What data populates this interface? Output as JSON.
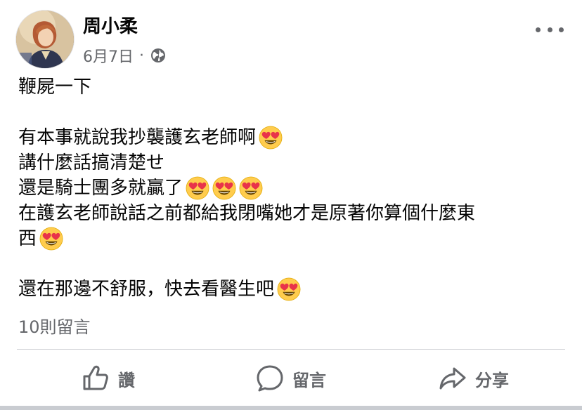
{
  "post": {
    "author_name": "周小柔",
    "date": "6月7日",
    "separator": "·",
    "privacy_icon": "globe-icon",
    "menu_icon": "more-horizontal-icon",
    "lines": [
      {
        "text": "鞭屍一下",
        "emoji_count": 0
      },
      {
        "text": "",
        "emoji_count": 0
      },
      {
        "text": "有本事就說我抄襲護玄老師啊",
        "emoji_count": 1
      },
      {
        "text": "講什麼話搞清楚せ",
        "emoji_count": 0
      },
      {
        "text": "還是騎士團多就贏了",
        "emoji_count": 3
      },
      {
        "text": "在護玄老師說話之前都給我閉嘴她才是原著你算個什麼東",
        "emoji_count": 0
      },
      {
        "text": "西",
        "emoji_count": 1
      },
      {
        "text": "",
        "emoji_count": 0
      },
      {
        "text": "還在那邊不舒服，快去看醫生吧",
        "emoji_count": 1
      }
    ],
    "emoji_name": "heart-eyes-emoji",
    "comment_count_label": "10則留言"
  },
  "actions": {
    "like_label": "讚",
    "comment_label": "留言",
    "share_label": "分享"
  },
  "colors": {
    "text_primary": "#050505",
    "text_secondary": "#65676b",
    "divider": "#ced0d4",
    "emoji_face": "#ffcc4d",
    "emoji_heart": "#e8334a"
  }
}
